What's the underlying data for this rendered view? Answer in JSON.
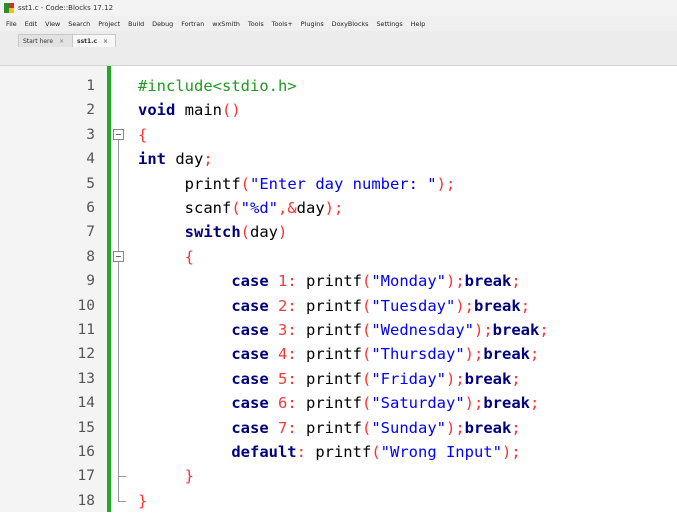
{
  "window": {
    "title": "sst1.c - Code::Blocks 17.12"
  },
  "menu": [
    "File",
    "Edit",
    "View",
    "Search",
    "Project",
    "Build",
    "Debug",
    "Fortran",
    "wxSmith",
    "Tools",
    "Tools+",
    "Plugins",
    "DoxyBlocks",
    "Settings",
    "Help"
  ],
  "tabs": [
    {
      "label": "Start here",
      "close": "×"
    },
    {
      "label": "sst1.c",
      "close": "×"
    }
  ],
  "editor": {
    "line_numbers": [
      "1",
      "2",
      "3",
      "4",
      "5",
      "6",
      "7",
      "8",
      "9",
      "10",
      "11",
      "12",
      "13",
      "14",
      "15",
      "16",
      "17",
      "18"
    ],
    "lines": [
      [
        {
          "t": "pp",
          "v": "#include<stdio.h>"
        }
      ],
      [
        {
          "t": "kw",
          "v": "void"
        },
        {
          "t": "id",
          "v": " main"
        },
        {
          "t": "op",
          "v": "()"
        }
      ],
      [
        {
          "t": "op",
          "v": "{"
        }
      ],
      [
        {
          "t": "kw",
          "v": "int"
        },
        {
          "t": "id",
          "v": " day"
        },
        {
          "t": "op",
          "v": ";"
        }
      ],
      [
        {
          "t": "id",
          "v": "     printf"
        },
        {
          "t": "op",
          "v": "("
        },
        {
          "t": "str",
          "v": "\"Enter day number: \""
        },
        {
          "t": "op",
          "v": ");"
        }
      ],
      [
        {
          "t": "id",
          "v": "     scanf"
        },
        {
          "t": "op",
          "v": "("
        },
        {
          "t": "str",
          "v": "\"%d\""
        },
        {
          "t": "op",
          "v": ",&"
        },
        {
          "t": "id",
          "v": "day"
        },
        {
          "t": "op",
          "v": ");"
        }
      ],
      [
        {
          "t": "kw",
          "v": "     switch"
        },
        {
          "t": "op",
          "v": "("
        },
        {
          "t": "id",
          "v": "day"
        },
        {
          "t": "op",
          "v": ")"
        }
      ],
      [
        {
          "t": "op",
          "v": "     {"
        }
      ],
      [
        {
          "t": "kw",
          "v": "          case"
        },
        {
          "t": "num",
          "v": " 1"
        },
        {
          "t": "op",
          "v": ":"
        },
        {
          "t": "id",
          "v": " printf"
        },
        {
          "t": "op",
          "v": "("
        },
        {
          "t": "str",
          "v": "\"Monday\""
        },
        {
          "t": "op",
          "v": ");"
        },
        {
          "t": "kw",
          "v": "break"
        },
        {
          "t": "op",
          "v": ";"
        }
      ],
      [
        {
          "t": "kw",
          "v": "          case"
        },
        {
          "t": "num",
          "v": " 2"
        },
        {
          "t": "op",
          "v": ":"
        },
        {
          "t": "id",
          "v": " printf"
        },
        {
          "t": "op",
          "v": "("
        },
        {
          "t": "str",
          "v": "\"Tuesday\""
        },
        {
          "t": "op",
          "v": ");"
        },
        {
          "t": "kw",
          "v": "break"
        },
        {
          "t": "op",
          "v": ";"
        }
      ],
      [
        {
          "t": "kw",
          "v": "          case"
        },
        {
          "t": "num",
          "v": " 3"
        },
        {
          "t": "op",
          "v": ":"
        },
        {
          "t": "id",
          "v": " printf"
        },
        {
          "t": "op",
          "v": "("
        },
        {
          "t": "str",
          "v": "\"Wednesday\""
        },
        {
          "t": "op",
          "v": ");"
        },
        {
          "t": "kw",
          "v": "break"
        },
        {
          "t": "op",
          "v": ";"
        }
      ],
      [
        {
          "t": "kw",
          "v": "          case"
        },
        {
          "t": "num",
          "v": " 4"
        },
        {
          "t": "op",
          "v": ":"
        },
        {
          "t": "id",
          "v": " printf"
        },
        {
          "t": "op",
          "v": "("
        },
        {
          "t": "str",
          "v": "\"Thursday\""
        },
        {
          "t": "op",
          "v": ");"
        },
        {
          "t": "kw",
          "v": "break"
        },
        {
          "t": "op",
          "v": ";"
        }
      ],
      [
        {
          "t": "kw",
          "v": "          case"
        },
        {
          "t": "num",
          "v": " 5"
        },
        {
          "t": "op",
          "v": ":"
        },
        {
          "t": "id",
          "v": " printf"
        },
        {
          "t": "op",
          "v": "("
        },
        {
          "t": "str",
          "v": "\"Friday\""
        },
        {
          "t": "op",
          "v": ");"
        },
        {
          "t": "kw",
          "v": "break"
        },
        {
          "t": "op",
          "v": ";"
        }
      ],
      [
        {
          "t": "kw",
          "v": "          case"
        },
        {
          "t": "num",
          "v": " 6"
        },
        {
          "t": "op",
          "v": ":"
        },
        {
          "t": "id",
          "v": " printf"
        },
        {
          "t": "op",
          "v": "("
        },
        {
          "t": "str",
          "v": "\"Saturday\""
        },
        {
          "t": "op",
          "v": ");"
        },
        {
          "t": "kw",
          "v": "break"
        },
        {
          "t": "op",
          "v": ";"
        }
      ],
      [
        {
          "t": "kw",
          "v": "          case"
        },
        {
          "t": "num",
          "v": " 7"
        },
        {
          "t": "op",
          "v": ":"
        },
        {
          "t": "id",
          "v": " printf"
        },
        {
          "t": "op",
          "v": "("
        },
        {
          "t": "str",
          "v": "\"Sunday\""
        },
        {
          "t": "op",
          "v": ");"
        },
        {
          "t": "kw",
          "v": "break"
        },
        {
          "t": "op",
          "v": ";"
        }
      ],
      [
        {
          "t": "kw",
          "v": "          default"
        },
        {
          "t": "op",
          "v": ":"
        },
        {
          "t": "id",
          "v": " printf"
        },
        {
          "t": "op",
          "v": "("
        },
        {
          "t": "str",
          "v": "\"Wrong Input\""
        },
        {
          "t": "op",
          "v": ");"
        }
      ],
      [
        {
          "t": "op",
          "v": "     }"
        }
      ],
      [
        {
          "t": "op",
          "v": "}"
        }
      ]
    ]
  }
}
